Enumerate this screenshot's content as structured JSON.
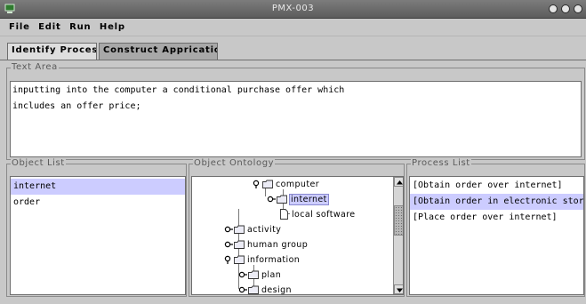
{
  "window": {
    "title": "PMX-003"
  },
  "menu": [
    "File",
    "Edit",
    "Run",
    "Help"
  ],
  "tabs": [
    {
      "label": "Identify Process",
      "active": true
    },
    {
      "label": "Construct Apprication",
      "active": false
    }
  ],
  "text_area": {
    "legend": "Text Area",
    "lines": [
      "inputting into the computer a conditional purchase offer which",
      "includes an offer price;"
    ]
  },
  "object_list": {
    "legend": "Object List",
    "items": [
      {
        "label": "internet",
        "selected": true
      },
      {
        "label": "order",
        "selected": false
      }
    ]
  },
  "ontology": {
    "legend": "Object Ontology",
    "nodes": [
      {
        "label": "computer",
        "type": "folder",
        "expanded": true
      },
      {
        "label": "internet",
        "type": "folder",
        "expanded": false,
        "selected": true
      },
      {
        "label": "local software",
        "type": "leaf"
      },
      {
        "label": "activity",
        "type": "folder",
        "expanded": false
      },
      {
        "label": "human group",
        "type": "folder",
        "expanded": false
      },
      {
        "label": "information",
        "type": "folder",
        "expanded": true
      },
      {
        "label": "plan",
        "type": "folder",
        "expanded": false
      },
      {
        "label": "design",
        "type": "folder",
        "expanded": false
      }
    ]
  },
  "process_list": {
    "legend": "Process List",
    "items": [
      {
        "label": "[Obtain order over internet]",
        "selected": false
      },
      {
        "label": "[Obtain order in electronic store]",
        "selected": true
      },
      {
        "label": "[Place order over internet]",
        "selected": false
      }
    ]
  },
  "colors": {
    "selection": "#ccccff",
    "titlebar": "#6a6a6a",
    "panel": "#c8c8c8"
  }
}
